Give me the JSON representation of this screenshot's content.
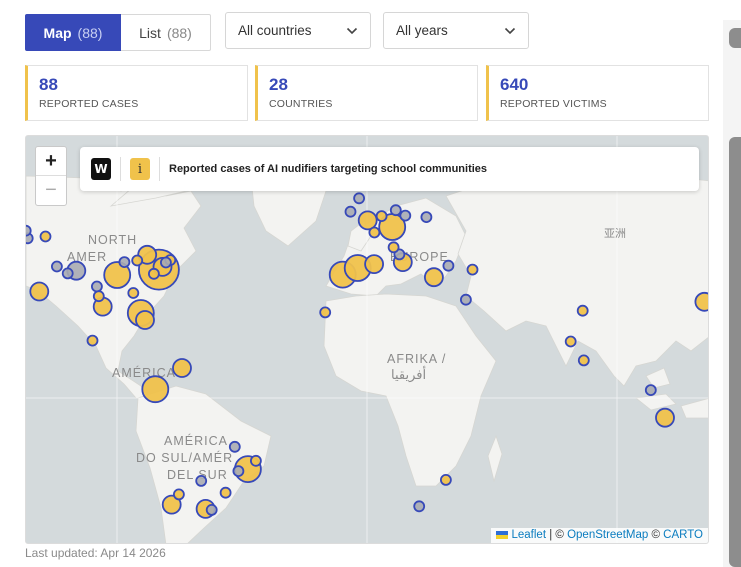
{
  "tabs": {
    "map_label": "Map",
    "map_count": "(88)",
    "list_label": "List",
    "list_count": "(88)"
  },
  "filters": {
    "countries": "All countries",
    "years": "All years"
  },
  "stats": [
    {
      "value": "88",
      "label": "REPORTED CASES"
    },
    {
      "value": "28",
      "label": "COUNTRIES"
    },
    {
      "value": "640",
      "label": "REPORTED VICTIMS"
    }
  ],
  "map": {
    "title": "Reported cases of AI nudifiers targeting school communities",
    "logo_letter": "W",
    "info_icon": "i",
    "zoom_in": "+",
    "zoom_out": "−",
    "labels": {
      "north": "NORTH",
      "amer": "AMER",
      "europe": "EUROPE",
      "afrika": "AFRIKA /",
      "afrika_ar": "أفريقيا",
      "america": "AMÉRICA",
      "sa1": "AMÉRICA",
      "sa2": "DO SUL/AMÉR",
      "sa3": "DEL SUR",
      "asia": "亚洲"
    },
    "attribution": {
      "leaflet": "Leaflet",
      "sep1": "| ©",
      "osm": "OpenStreetMap",
      "sep2": "©",
      "carto": "CARTO"
    },
    "colors": {
      "marker_fill": "#f0c24b",
      "marker_stroke": "#3749b8",
      "grey_marker": "#a9abb2",
      "land": "#f3f3f1",
      "water": "#d4dadc"
    },
    "markers": [
      {
        "lon": -122.4,
        "lat": 47.6,
        "size": "small",
        "color": "grey"
      },
      {
        "lon": -123.1,
        "lat": 49.3,
        "size": "small",
        "color": "grey"
      },
      {
        "lon": -116.0,
        "lat": 48.0,
        "size": "small",
        "color": "yellow"
      },
      {
        "lon": -111.9,
        "lat": 40.8,
        "size": "small",
        "color": "grey"
      },
      {
        "lon": -118.2,
        "lat": 34.1,
        "size": "medium",
        "color": "yellow"
      },
      {
        "lon": -97.5,
        "lat": 35.5,
        "size": "small",
        "color": "grey"
      },
      {
        "lon": -96.8,
        "lat": 32.8,
        "size": "small",
        "color": "yellow"
      },
      {
        "lon": -95.4,
        "lat": 29.8,
        "size": "medium",
        "color": "yellow"
      },
      {
        "lon": -90.2,
        "lat": 38.6,
        "size": "large",
        "color": "yellow"
      },
      {
        "lon": -87.6,
        "lat": 41.9,
        "size": "small",
        "color": "grey"
      },
      {
        "lon": -84.4,
        "lat": 33.7,
        "size": "small",
        "color": "yellow"
      },
      {
        "lon": -81.7,
        "lat": 27.9,
        "size": "large",
        "color": "yellow"
      },
      {
        "lon": -80.2,
        "lat": 25.8,
        "size": "medium",
        "color": "yellow"
      },
      {
        "lon": -83.0,
        "lat": 42.3,
        "size": "small",
        "color": "yellow"
      },
      {
        "lon": -79.4,
        "lat": 43.7,
        "size": "medium",
        "color": "yellow"
      },
      {
        "lon": -75.2,
        "lat": 40.0,
        "size": "xlarge",
        "color": "yellow"
      },
      {
        "lon": -77.0,
        "lat": 38.9,
        "size": "small",
        "color": "yellow"
      },
      {
        "lon": -73.9,
        "lat": 40.7,
        "size": "medium",
        "color": "yellow"
      },
      {
        "lon": -71.1,
        "lat": 42.4,
        "size": "small",
        "color": "yellow"
      },
      {
        "lon": -72.7,
        "lat": 41.8,
        "size": "small",
        "color": "grey"
      },
      {
        "lon": -99.1,
        "lat": 19.4,
        "size": "small",
        "color": "yellow"
      },
      {
        "lon": -76.5,
        "lat": 3.4,
        "size": "large",
        "color": "yellow"
      },
      {
        "lon": -66.9,
        "lat": 10.5,
        "size": "medium",
        "color": "yellow"
      },
      {
        "lon": -43.2,
        "lat": -22.9,
        "size": "large",
        "color": "yellow"
      },
      {
        "lon": -46.6,
        "lat": -23.5,
        "size": "small",
        "color": "grey"
      },
      {
        "lon": -40.3,
        "lat": -20.3,
        "size": "small",
        "color": "yellow"
      },
      {
        "lon": -47.9,
        "lat": -15.8,
        "size": "small",
        "color": "grey"
      },
      {
        "lon": -51.2,
        "lat": -30.0,
        "size": "small",
        "color": "yellow"
      },
      {
        "lon": -58.4,
        "lat": -34.6,
        "size": "medium",
        "color": "yellow"
      },
      {
        "lon": -56.2,
        "lat": -34.9,
        "size": "small",
        "color": "grey"
      },
      {
        "lon": -70.6,
        "lat": -33.4,
        "size": "medium",
        "color": "yellow"
      },
      {
        "lon": -68.0,
        "lat": -30.5,
        "size": "small",
        "color": "yellow"
      },
      {
        "lon": -60.0,
        "lat": -26.5,
        "size": "small",
        "color": "grey"
      },
      {
        "lon": -6.3,
        "lat": 53.3,
        "size": "small",
        "color": "grey"
      },
      {
        "lon": -3.2,
        "lat": 55.9,
        "size": "small",
        "color": "grey"
      },
      {
        "lon": -0.1,
        "lat": 51.5,
        "size": "medium",
        "color": "yellow"
      },
      {
        "lon": -9.1,
        "lat": 38.7,
        "size": "large",
        "color": "yellow"
      },
      {
        "lon": -3.7,
        "lat": 40.4,
        "size": "large",
        "color": "yellow"
      },
      {
        "lon": 2.3,
        "lat": 48.9,
        "size": "small",
        "color": "yellow"
      },
      {
        "lon": 4.9,
        "lat": 52.4,
        "size": "small",
        "color": "yellow"
      },
      {
        "lon": 10.0,
        "lat": 53.6,
        "size": "small",
        "color": "grey"
      },
      {
        "lon": 8.7,
        "lat": 50.1,
        "size": "large",
        "color": "yellow"
      },
      {
        "lon": 13.4,
        "lat": 52.5,
        "size": "small",
        "color": "grey"
      },
      {
        "lon": 18.1,
        "lat": 59.3,
        "size": "small",
        "color": "yellow"
      },
      {
        "lon": 12.5,
        "lat": 41.9,
        "size": "medium",
        "color": "yellow"
      },
      {
        "lon": 11.3,
        "lat": 43.8,
        "size": "small",
        "color": "grey"
      },
      {
        "lon": 9.2,
        "lat": 45.5,
        "size": "small",
        "color": "yellow"
      },
      {
        "lon": 2.2,
        "lat": 41.4,
        "size": "medium",
        "color": "yellow"
      },
      {
        "lon": 21.0,
        "lat": 52.2,
        "size": "small",
        "color": "grey"
      },
      {
        "lon": 23.7,
        "lat": 38.0,
        "size": "medium",
        "color": "yellow"
      },
      {
        "lon": 28.9,
        "lat": 41.0,
        "size": "small",
        "color": "grey"
      },
      {
        "lon": 35.2,
        "lat": 31.8,
        "size": "small",
        "color": "grey"
      },
      {
        "lon": 37.6,
        "lat": 40.0,
        "size": "small",
        "color": "yellow"
      },
      {
        "lon": -15.4,
        "lat": 28.1,
        "size": "small",
        "color": "yellow"
      },
      {
        "lon": 72.9,
        "lat": 19.1,
        "size": "small",
        "color": "yellow"
      },
      {
        "lon": 77.2,
        "lat": 28.6,
        "size": "small",
        "color": "yellow"
      },
      {
        "lon": 77.6,
        "lat": 13.0,
        "size": "small",
        "color": "yellow"
      },
      {
        "lon": 101.7,
        "lat": 3.1,
        "size": "small",
        "color": "grey"
      },
      {
        "lon": 106.8,
        "lat": -6.2,
        "size": "medium",
        "color": "yellow"
      },
      {
        "lon": 121.0,
        "lat": 31.2,
        "size": "medium",
        "color": "yellow"
      },
      {
        "lon": 28.0,
        "lat": -26.2,
        "size": "small",
        "color": "yellow"
      },
      {
        "lon": 18.4,
        "lat": -33.9,
        "size": "small",
        "color": "grey"
      },
      {
        "lon": -104.9,
        "lat": 39.7,
        "size": "medium",
        "color": "grey"
      },
      {
        "lon": -108.0,
        "lat": 39.0,
        "size": "small",
        "color": "grey"
      }
    ]
  },
  "footer": {
    "updated": "Last updated: Apr 14 2026"
  }
}
